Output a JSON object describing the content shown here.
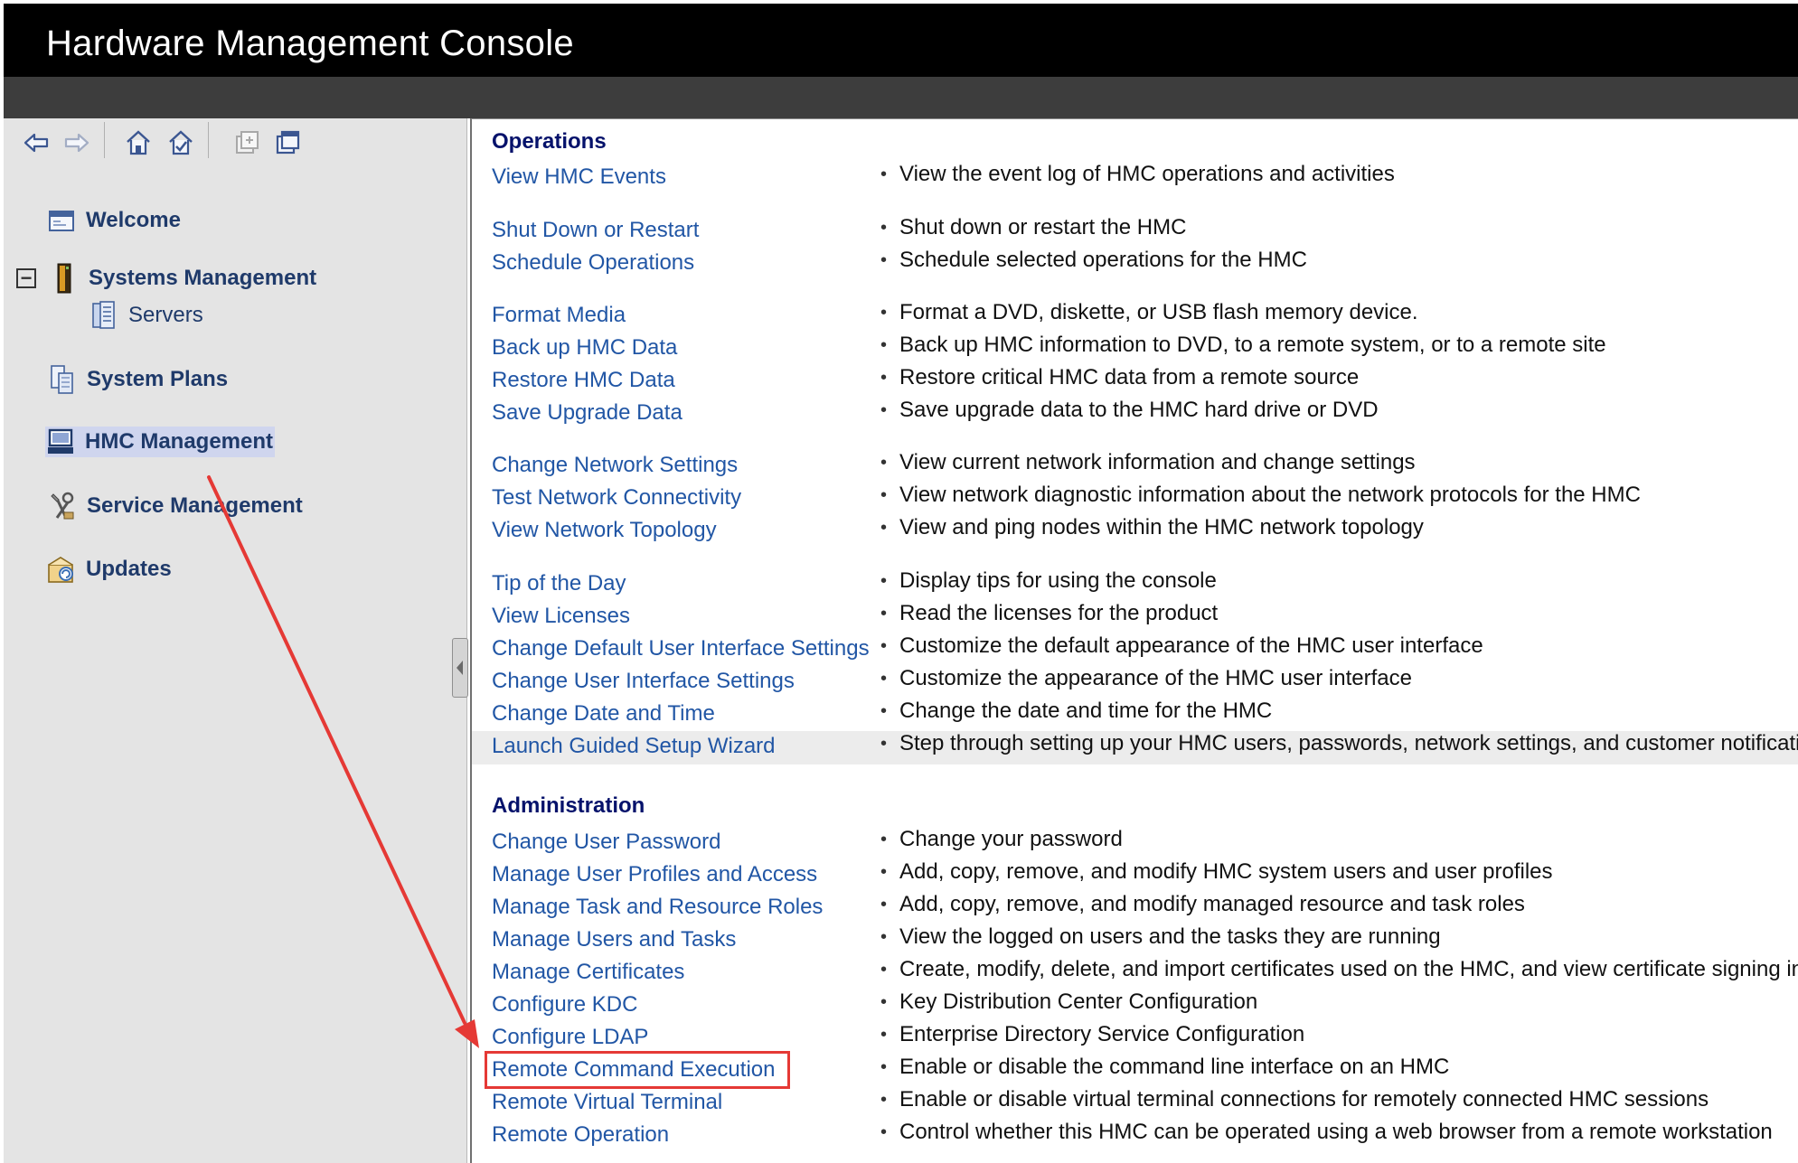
{
  "app": {
    "title": "Hardware Management Console"
  },
  "toolbar": {
    "buttons": [
      {
        "name": "back-icon"
      },
      {
        "name": "forward-icon"
      },
      {
        "name": "home-icon"
      },
      {
        "name": "set-home-icon"
      },
      {
        "name": "new-window-icon"
      },
      {
        "name": "window-icon"
      }
    ]
  },
  "sidebar": {
    "items": [
      {
        "label": "Welcome",
        "icon": "welcome-window-icon"
      },
      {
        "label": "Systems Management",
        "icon": "server-rack-icon",
        "expanded": true
      },
      {
        "label": "Servers",
        "icon": "servers-icon"
      },
      {
        "label": "System Plans",
        "icon": "system-plans-icon"
      },
      {
        "label": "HMC Management",
        "icon": "computer-icon",
        "selected": true
      },
      {
        "label": "Service Management",
        "icon": "tools-icon"
      },
      {
        "label": "Updates",
        "icon": "updates-icon"
      }
    ],
    "collapse_glyph": "−"
  },
  "operations": {
    "title": "Operations",
    "tasks": [
      {
        "label": "View HMC Events",
        "desc": "View the event log of HMC operations and activities"
      },
      {
        "label": "Shut Down or Restart",
        "desc": "Shut down or restart the HMC"
      },
      {
        "label": "Schedule Operations",
        "desc": "Schedule selected operations for the HMC"
      },
      {
        "label": "Format Media",
        "desc": "Format a DVD, diskette, or USB flash memory device."
      },
      {
        "label": "Back up HMC Data",
        "desc": "Back up HMC information to DVD, to a remote system, or to a remote site"
      },
      {
        "label": "Restore HMC Data",
        "desc": "Restore critical HMC data from a remote source"
      },
      {
        "label": "Save Upgrade Data",
        "desc": "Save upgrade data to the HMC hard drive or DVD"
      },
      {
        "label": "Change Network Settings",
        "desc": "View current network information and change settings"
      },
      {
        "label": "Test Network Connectivity",
        "desc": "View network diagnostic information about the network protocols for the HMC"
      },
      {
        "label": "View Network Topology",
        "desc": "View and ping nodes within the HMC network topology"
      },
      {
        "label": "Tip of the Day",
        "desc": "Display tips for using the console"
      },
      {
        "label": "View Licenses",
        "desc": "Read the licenses for the product"
      },
      {
        "label": "Change Default User Interface Settings",
        "desc": "Customize the default appearance of the HMC user interface"
      },
      {
        "label": "Change User Interface Settings",
        "desc": "Customize the appearance of the HMC user interface"
      },
      {
        "label": "Change Date and Time",
        "desc": "Change the date and time for the HMC"
      },
      {
        "label": "Launch Guided Setup Wizard",
        "desc": "Step through setting up your HMC users, passwords, network settings, and customer notification"
      }
    ]
  },
  "administration": {
    "title": "Administration",
    "tasks": [
      {
        "label": "Change User Password",
        "desc": "Change your password"
      },
      {
        "label": "Manage User Profiles and Access",
        "desc": "Add, copy, remove, and modify HMC system users and user profiles"
      },
      {
        "label": "Manage Task and Resource Roles",
        "desc": "Add, copy, remove, and modify managed resource and task roles"
      },
      {
        "label": "Manage Users and Tasks",
        "desc": "View the logged on users and the tasks they are running"
      },
      {
        "label": "Manage Certificates",
        "desc": "Create, modify, delete, and import certificates used on the HMC, and view certificate signing info"
      },
      {
        "label": "Configure KDC",
        "desc": "Key Distribution Center Configuration"
      },
      {
        "label": "Configure LDAP",
        "desc": "Enterprise Directory Service Configuration"
      },
      {
        "label": "Remote Command Execution",
        "desc": "Enable or disable the command line interface on an HMC"
      },
      {
        "label": "Remote Virtual Terminal",
        "desc": "Enable or disable virtual terminal connections for remotely connected HMC sessions"
      },
      {
        "label": "Remote Operation",
        "desc": "Control whether this HMC can be operated using a web browser from a remote workstation"
      }
    ]
  },
  "annotation": {
    "color": "#e53935"
  },
  "colors": {
    "link": "#2156a5",
    "section": "#05126b",
    "nav": "#1f3a6a",
    "titlebar": "#000000"
  }
}
